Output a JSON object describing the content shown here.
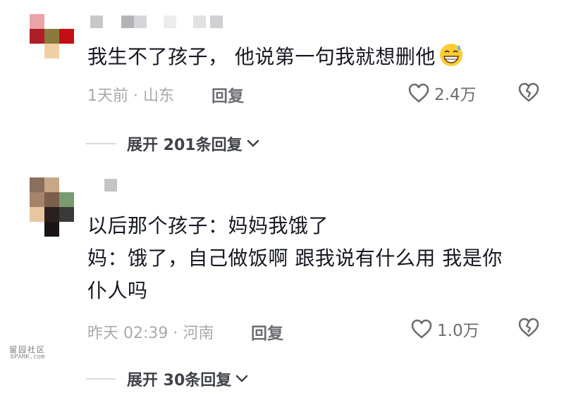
{
  "comments": [
    {
      "text": "我生不了孩子， 他说第一句我就想删他",
      "emoji": "grinning-sweat-emoji",
      "meta": "1天前 · 山东",
      "reply_label": "回复",
      "likes": "2.4万",
      "expand_label": "展开 201条回复"
    },
    {
      "lines": [
        "以后那个孩子：妈妈我饿了",
        "妈：饿了，自己做饭啊 跟我说有什么用 我是你",
        "仆人吗"
      ],
      "meta": "昨天 02:39 · 河南",
      "reply_label": "回复",
      "likes": "1.0万",
      "expand_label": "展开 30条回复"
    }
  ],
  "watermark": {
    "glyphs": "留园社区",
    "site": "6PARK.com"
  },
  "colors": {
    "text": "#161823",
    "meta": "#a8a9ad",
    "icon": "#6b6d73"
  }
}
